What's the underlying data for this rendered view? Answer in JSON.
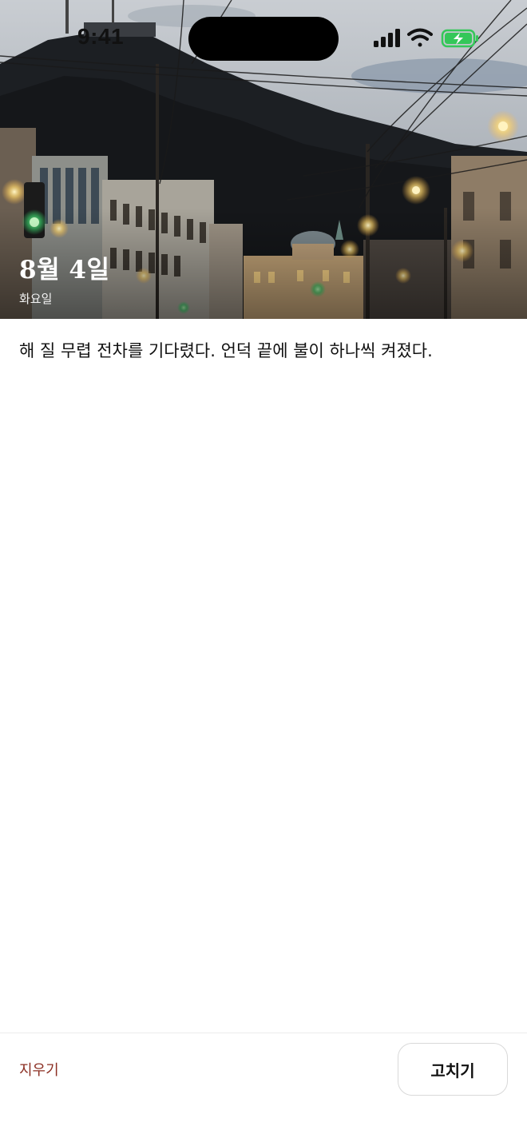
{
  "status_bar": {
    "time": "9:41",
    "icons": [
      "cellular-signal-icon",
      "wifi-icon",
      "battery-charging-icon"
    ],
    "battery_color": "#34c759"
  },
  "entry": {
    "date": "8월 4일",
    "weekday": "화요일",
    "text": "해 질 무렵 전차를 기다렸다. 언덕 끝에 불이 하나씩 켜졌다."
  },
  "footer": {
    "delete_label": "지우기",
    "edit_label": "고치기"
  },
  "colors": {
    "delete_accent": "#8b2e22"
  }
}
